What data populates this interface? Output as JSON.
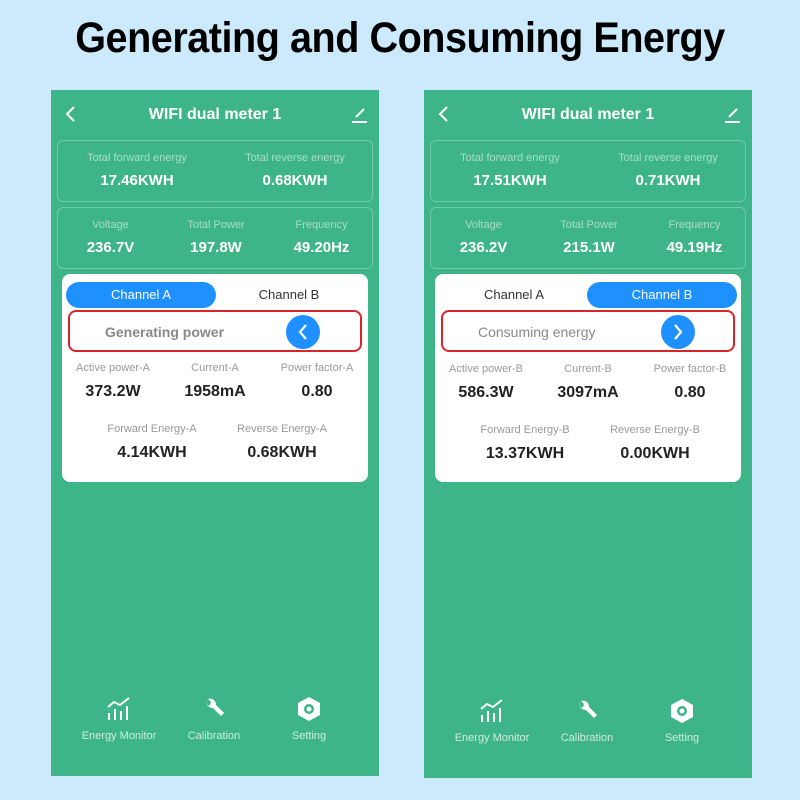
{
  "headline": "Generating and Consuming Energy",
  "screens": [
    {
      "title": "WIFI dual meter 1",
      "totals": {
        "forward_label": "Total  forward energy",
        "forward_value": "17.46KWH",
        "reverse_label": "Total reverse energy",
        "reverse_value": "0.68KWH"
      },
      "metrics": {
        "voltage_label": "Voltage",
        "voltage_value": "236.7V",
        "power_label": "Total Power",
        "power_value": "197.8W",
        "frequency_label": "Frequency",
        "frequency_value": "49.20Hz"
      },
      "tabs": [
        "Channel A",
        "Channel B"
      ],
      "active_tab": "Channel A",
      "mode": {
        "label": "Generating power",
        "icon": "chevron-left-icon"
      },
      "channel": {
        "active_power_label": "Active power-A",
        "active_power_value": "373.2W",
        "current_label": "Current-A",
        "current_value": "1958mA",
        "power_factor_label": "Power factor-A",
        "power_factor_value": "0.80",
        "forward_energy_label": "Forward Energy-A",
        "forward_energy_value": "4.14KWH",
        "reverse_energy_label": "Reverse Energy-A",
        "reverse_energy_value": "0.68KWH"
      },
      "nav": [
        {
          "label": "Energy Monitor",
          "icon": "chart-icon"
        },
        {
          "label": "Calibration",
          "icon": "wrench-icon"
        },
        {
          "label": "Setting",
          "icon": "hex-gear-icon"
        }
      ]
    },
    {
      "title": "WIFI dual meter 1",
      "totals": {
        "forward_label": "Total  forward energy",
        "forward_value": "17.51KWH",
        "reverse_label": "Total reverse energy",
        "reverse_value": "0.71KWH"
      },
      "metrics": {
        "voltage_label": "Voltage",
        "voltage_value": "236.2V",
        "power_label": "Total Power",
        "power_value": "215.1W",
        "frequency_label": "Frequency",
        "frequency_value": "49.19Hz"
      },
      "tabs": [
        "Channel A",
        "Channel B"
      ],
      "active_tab": "Channel B",
      "mode": {
        "label": "Consuming energy",
        "icon": "chevron-right-icon"
      },
      "channel": {
        "active_power_label": "Active power-B",
        "active_power_value": "586.3W",
        "current_label": "Current-B",
        "current_value": "3097mA",
        "power_factor_label": "Power factor-B",
        "power_factor_value": "0.80",
        "forward_energy_label": "Forward Energy-B",
        "forward_energy_value": "13.37KWH",
        "reverse_energy_label": "Reverse Energy-B",
        "reverse_energy_value": "0.00KWH"
      },
      "nav": [
        {
          "label": "Energy Monitor",
          "icon": "chart-icon"
        },
        {
          "label": "Calibration",
          "icon": "wrench-icon"
        },
        {
          "label": "Setting",
          "icon": "hex-gear-icon"
        }
      ]
    }
  ],
  "colors": {
    "background": "#cdeafc",
    "app_green": "#3eb489",
    "accent_blue": "#1e90ff",
    "highlight_red": "#d6262b"
  }
}
